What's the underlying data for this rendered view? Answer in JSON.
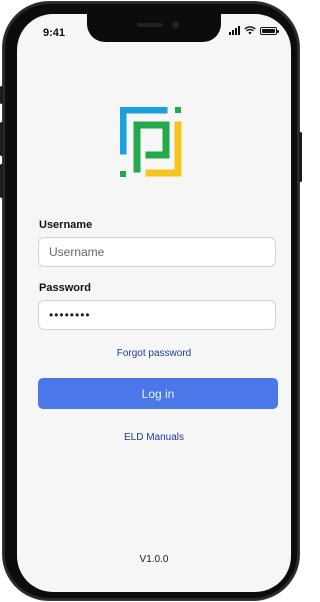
{
  "status_bar": {
    "time": "9:41"
  },
  "logo": {
    "name": "app-logo",
    "colors": {
      "blue": "#1aa0dc",
      "green": "#23a94b",
      "yellow": "#f4c51c"
    }
  },
  "login_form": {
    "username_label": "Username",
    "username_placeholder": "Username",
    "username_value": "",
    "password_label": "Password",
    "password_value": "••••••••",
    "forgot_password": "Forgot password",
    "login_button": "Log in"
  },
  "links": {
    "eld_manuals": "ELD Manuals"
  },
  "footer": {
    "version": "V1.0.0"
  },
  "colors": {
    "accent": "#4a78e8",
    "link": "#1f3c9a"
  }
}
